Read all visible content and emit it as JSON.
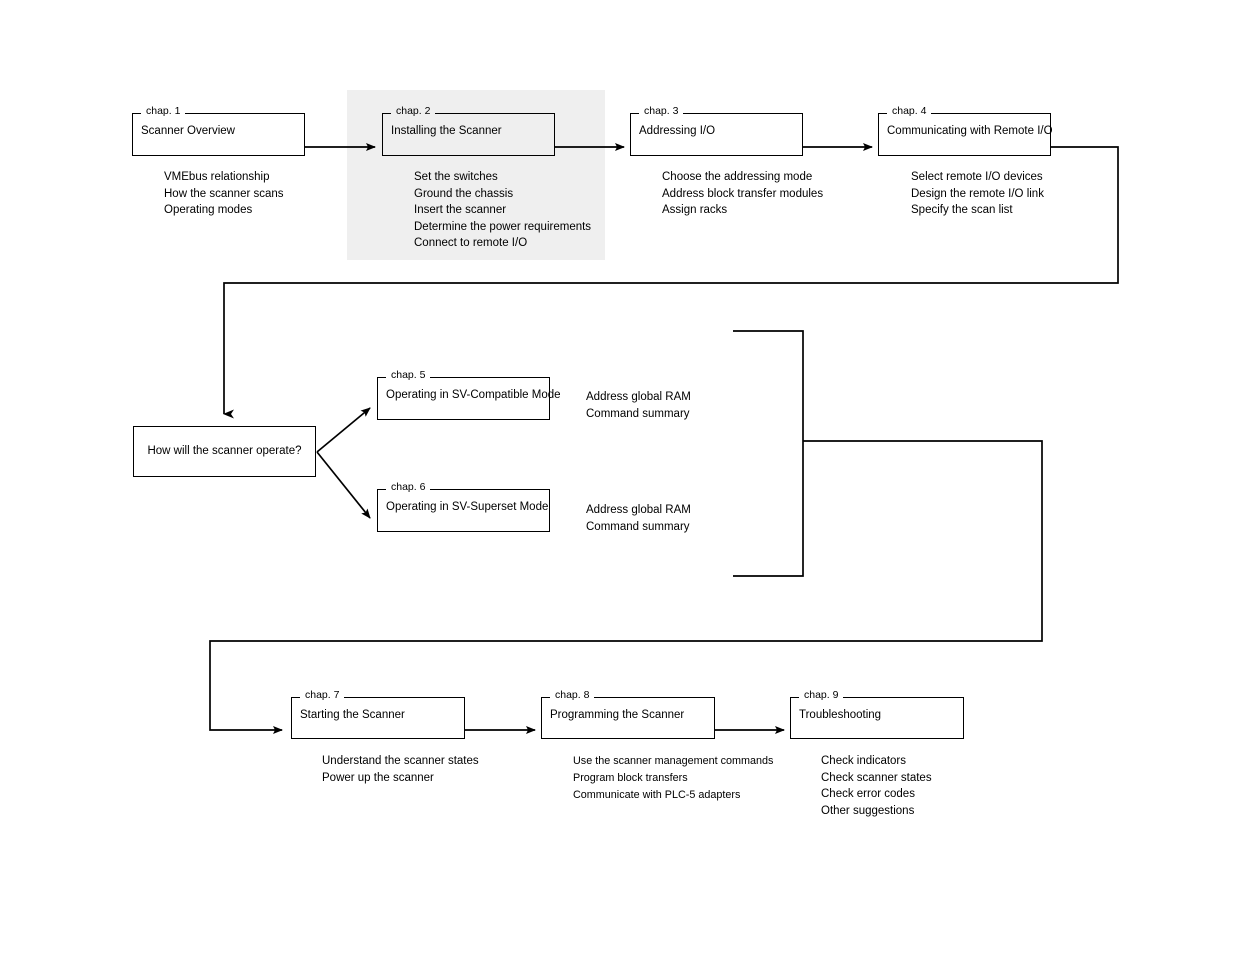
{
  "diagram": {
    "title": "Scanner manual chapter roadmap",
    "line_color": "#000000",
    "highlight_color": "#efefef"
  },
  "chapters": [
    {
      "tag": "chap. 1",
      "title": "Scanner Overview",
      "topics": [
        "VMEbus relationship",
        "How the scanner scans",
        "Operating modes"
      ]
    },
    {
      "tag": "chap. 2",
      "title": "Installing the Scanner",
      "topics": [
        "Set the switches",
        "Ground the chassis",
        "Insert the scanner",
        "Determine the power requirements",
        "Connect to remote I/O"
      ]
    },
    {
      "tag": "chap. 3",
      "title": "Addressing I/O",
      "topics": [
        "Choose the addressing mode",
        "Address block transfer modules",
        "Assign racks"
      ]
    },
    {
      "tag": "chap. 4",
      "title": "Communicating with Remote I/O",
      "topics": [
        "Select remote I/O devices",
        "Design the remote I/O link",
        "Specify the scan list"
      ]
    },
    {
      "tag": "chap. 5",
      "title": "Operating in SV-Compatible Mode",
      "topics": [
        "Address global RAM",
        "Command summary"
      ]
    },
    {
      "tag": "chap. 6",
      "title": "Operating in SV-Superset Mode",
      "topics": [
        "Address global RAM",
        "Command summary"
      ]
    },
    {
      "tag": "chap. 7",
      "title": "Starting the Scanner",
      "topics": [
        "Understand the scanner states",
        "Power up the scanner"
      ]
    },
    {
      "tag": "chap. 8",
      "title": "Programming the Scanner",
      "topics": [
        "Use the scanner management commands",
        "Program block transfers",
        "Communicate with PLC-5 adapters"
      ]
    },
    {
      "tag": "chap. 9",
      "title": "Troubleshooting",
      "topics": [
        "Check indicators",
        "Check scanner states",
        "Check error codes",
        "Other suggestions"
      ]
    }
  ],
  "decision": {
    "title": "How will the scanner operate?"
  }
}
